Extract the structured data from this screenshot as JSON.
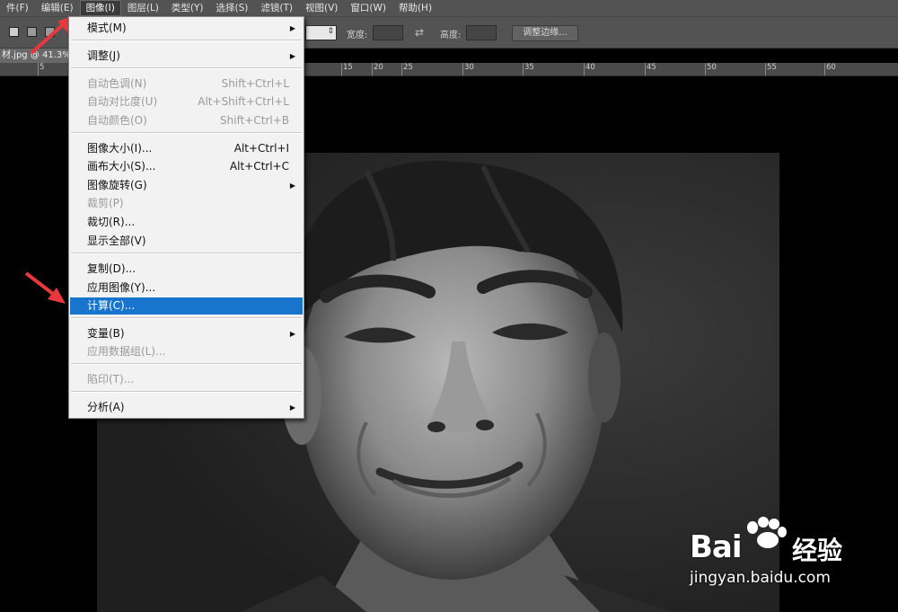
{
  "menubar": {
    "items": [
      "件(F)",
      "编辑(E)",
      "图像(I)",
      "图层(L)",
      "类型(Y)",
      "选择(S)",
      "滤镜(T)",
      "视图(V)",
      "窗口(W)",
      "帮助(H)"
    ]
  },
  "options_bar": {
    "width_label": "宽度:",
    "height_label": "高度:",
    "refine_edge_label": "调整边缘..."
  },
  "document": {
    "tab_title": "材.jpg @ 41.3%"
  },
  "ruler": {
    "labels": [
      "5",
      "15",
      "20",
      "25",
      "30",
      "35",
      "40",
      "45",
      "50",
      "55",
      "60"
    ]
  },
  "image_menu": {
    "items": [
      {
        "label": "模式(M)",
        "shortcut": "",
        "submenu": true,
        "disabled": false
      },
      {
        "label": "调整(J)",
        "shortcut": "",
        "submenu": true,
        "disabled": false
      },
      {
        "label": "自动色调(N)",
        "shortcut": "Shift+Ctrl+L",
        "submenu": false,
        "disabled": true
      },
      {
        "label": "自动对比度(U)",
        "shortcut": "Alt+Shift+Ctrl+L",
        "submenu": false,
        "disabled": true
      },
      {
        "label": "自动颜色(O)",
        "shortcut": "Shift+Ctrl+B",
        "submenu": false,
        "disabled": true
      },
      {
        "label": "图像大小(I)...",
        "shortcut": "Alt+Ctrl+I",
        "submenu": false,
        "disabled": false
      },
      {
        "label": "画布大小(S)...",
        "shortcut": "Alt+Ctrl+C",
        "submenu": false,
        "disabled": false
      },
      {
        "label": "图像旋转(G)",
        "shortcut": "",
        "submenu": true,
        "disabled": false
      },
      {
        "label": "裁剪(P)",
        "shortcut": "",
        "submenu": false,
        "disabled": true
      },
      {
        "label": "裁切(R)...",
        "shortcut": "",
        "submenu": false,
        "disabled": false
      },
      {
        "label": "显示全部(V)",
        "shortcut": "",
        "submenu": false,
        "disabled": false
      },
      {
        "label": "复制(D)...",
        "shortcut": "",
        "submenu": false,
        "disabled": false
      },
      {
        "label": "应用图像(Y)...",
        "shortcut": "",
        "submenu": false,
        "disabled": false
      },
      {
        "label": "计算(C)...",
        "shortcut": "",
        "submenu": false,
        "disabled": false,
        "highlighted": true
      },
      {
        "label": "变量(B)",
        "shortcut": "",
        "submenu": true,
        "disabled": false
      },
      {
        "label": "应用数据组(L)...",
        "shortcut": "",
        "submenu": false,
        "disabled": true
      },
      {
        "label": "陷印(T)...",
        "shortcut": "",
        "submenu": false,
        "disabled": true
      },
      {
        "label": "分析(A)",
        "shortcut": "",
        "submenu": true,
        "disabled": false
      }
    ]
  },
  "watermark": {
    "logo": "Bai",
    "logo_suffix": "du",
    "cn": "经验",
    "url": "jingyan.baidu.com"
  },
  "colors": {
    "menubar_bg": "#535353",
    "highlight": "#1874cd",
    "annotation_arrow": "#e8383d"
  }
}
